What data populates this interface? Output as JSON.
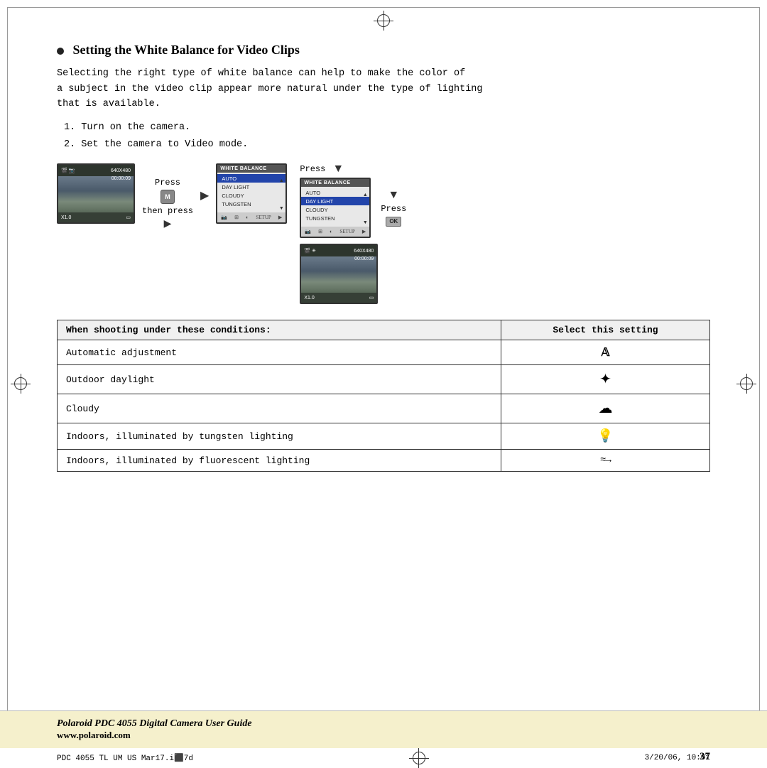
{
  "page": {
    "title": "Setting the White Balance for Video Clips",
    "body_text_1": "Selecting the right type of white balance can help to make the color of",
    "body_text_2": "a subject in the video clip appear more natural under the type of lighting",
    "body_text_3": "that is available.",
    "step1": "1.  Turn on the camera.",
    "step2": "2.  Set the camera to Video mode.",
    "press_label": "Press",
    "then_press_label": "then press",
    "press2_label": "Press",
    "press3_label": "Press",
    "camera_res": "640X480",
    "camera_time": "00:00:09",
    "camera_zoom": "X1.0",
    "menu_title": "WHITE BALANCE",
    "menu_items": [
      "AUTO",
      "DAY LIGHT",
      "CLOUDY",
      "TUNGSTEN"
    ],
    "menu_selected": "AUTO",
    "table": {
      "col1_header": "When shooting under these conditions:",
      "col2_header": "Select this setting",
      "rows": [
        {
          "condition": "Automatic adjustment",
          "icon": "🅐",
          "icon_type": "auto"
        },
        {
          "condition": "Outdoor daylight",
          "icon": "☀",
          "icon_type": "sun"
        },
        {
          "condition": "Cloudy",
          "icon": "☁",
          "icon_type": "cloud"
        },
        {
          "condition": "Indoors, illuminated by tungsten lighting",
          "icon": "💡",
          "icon_type": "bulb"
        },
        {
          "condition": "Indoors, illuminated by fluorescent lighting",
          "icon": "≈",
          "icon_type": "fluoro"
        }
      ]
    },
    "footer": {
      "brand": "Polaroid PDC 4055 Digital Camera User Guide",
      "url": "www.polaroid.com",
      "left_text": "PDC 4055 TL UM US Mar17.i⬛7d",
      "right_text": "3/20/06, 10:01",
      "page_number": "37"
    }
  }
}
